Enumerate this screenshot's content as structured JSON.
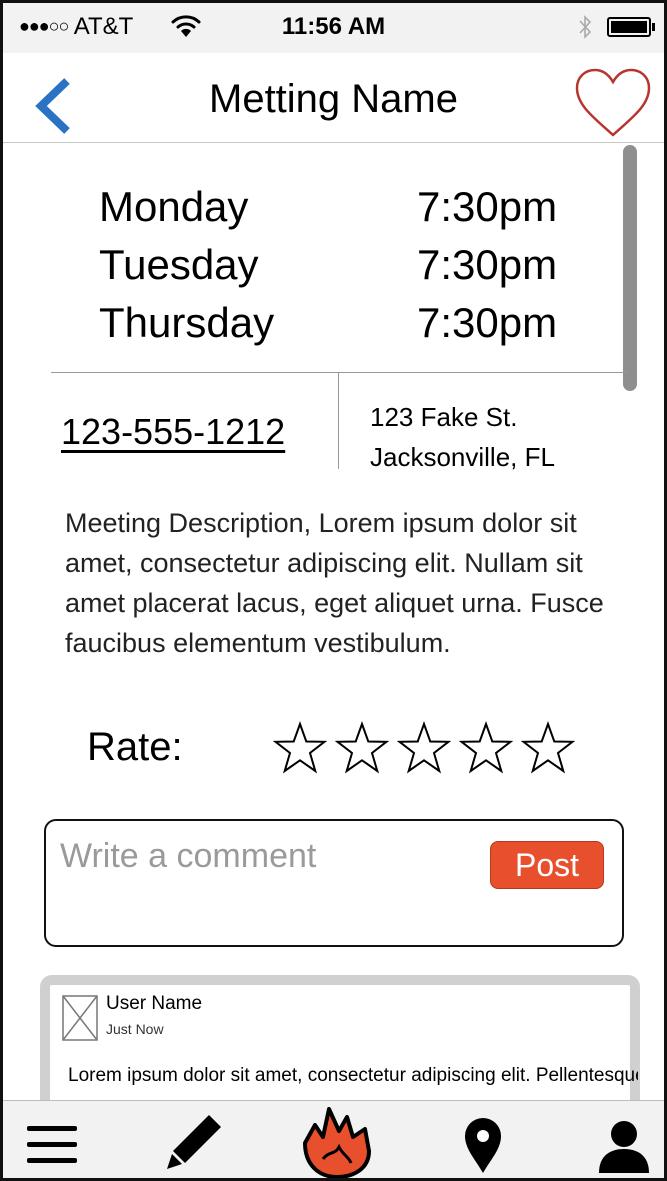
{
  "status_bar": {
    "signal_dots": "●●●○○",
    "carrier": "AT&T",
    "time": "11:56 AM",
    "icons": [
      "wifi-icon",
      "bluetooth-icon",
      "battery-icon"
    ],
    "battery_level": 1.0
  },
  "nav": {
    "title": "Metting Name",
    "back_icon": "chevron-left-icon",
    "favorite_icon": "heart-icon",
    "back_color": "#2a72c4",
    "heart_color": "#b8352f"
  },
  "schedule": [
    {
      "day": "Monday",
      "time": "7:30pm"
    },
    {
      "day": "Tuesday",
      "time": "7:30pm"
    },
    {
      "day": "Thursday",
      "time": "7:30pm"
    }
  ],
  "contact": {
    "phone": "123-555-1212",
    "address_line1": "123 Fake St.",
    "address_line2": "Jacksonville, FL"
  },
  "description": "Meeting Description, Lorem ipsum dolor sit amet, consectetur adipiscing elit. Nullam sit amet placerat lacus, eget aliquet urna. Fusce faucibus elementum vestibulum.",
  "rating": {
    "label": "Rate:",
    "max": 5,
    "value": 0
  },
  "comment_input": {
    "placeholder": "Write a comment",
    "value": "",
    "post_label": "Post",
    "post_color": "#e8502d"
  },
  "comments": [
    {
      "user_name": "User Name",
      "posted": "Just Now",
      "text": "Lorem ipsum dolor sit amet, consectetur adipiscing elit. Pellentesque rutrum facilisis pharetra. Nam eu tempus"
    }
  ],
  "tab_bar": {
    "items": [
      "menu-icon",
      "pencil-icon",
      "flame-icon",
      "map-pin-icon",
      "profile-icon"
    ],
    "flame_color": "#e8502d"
  }
}
